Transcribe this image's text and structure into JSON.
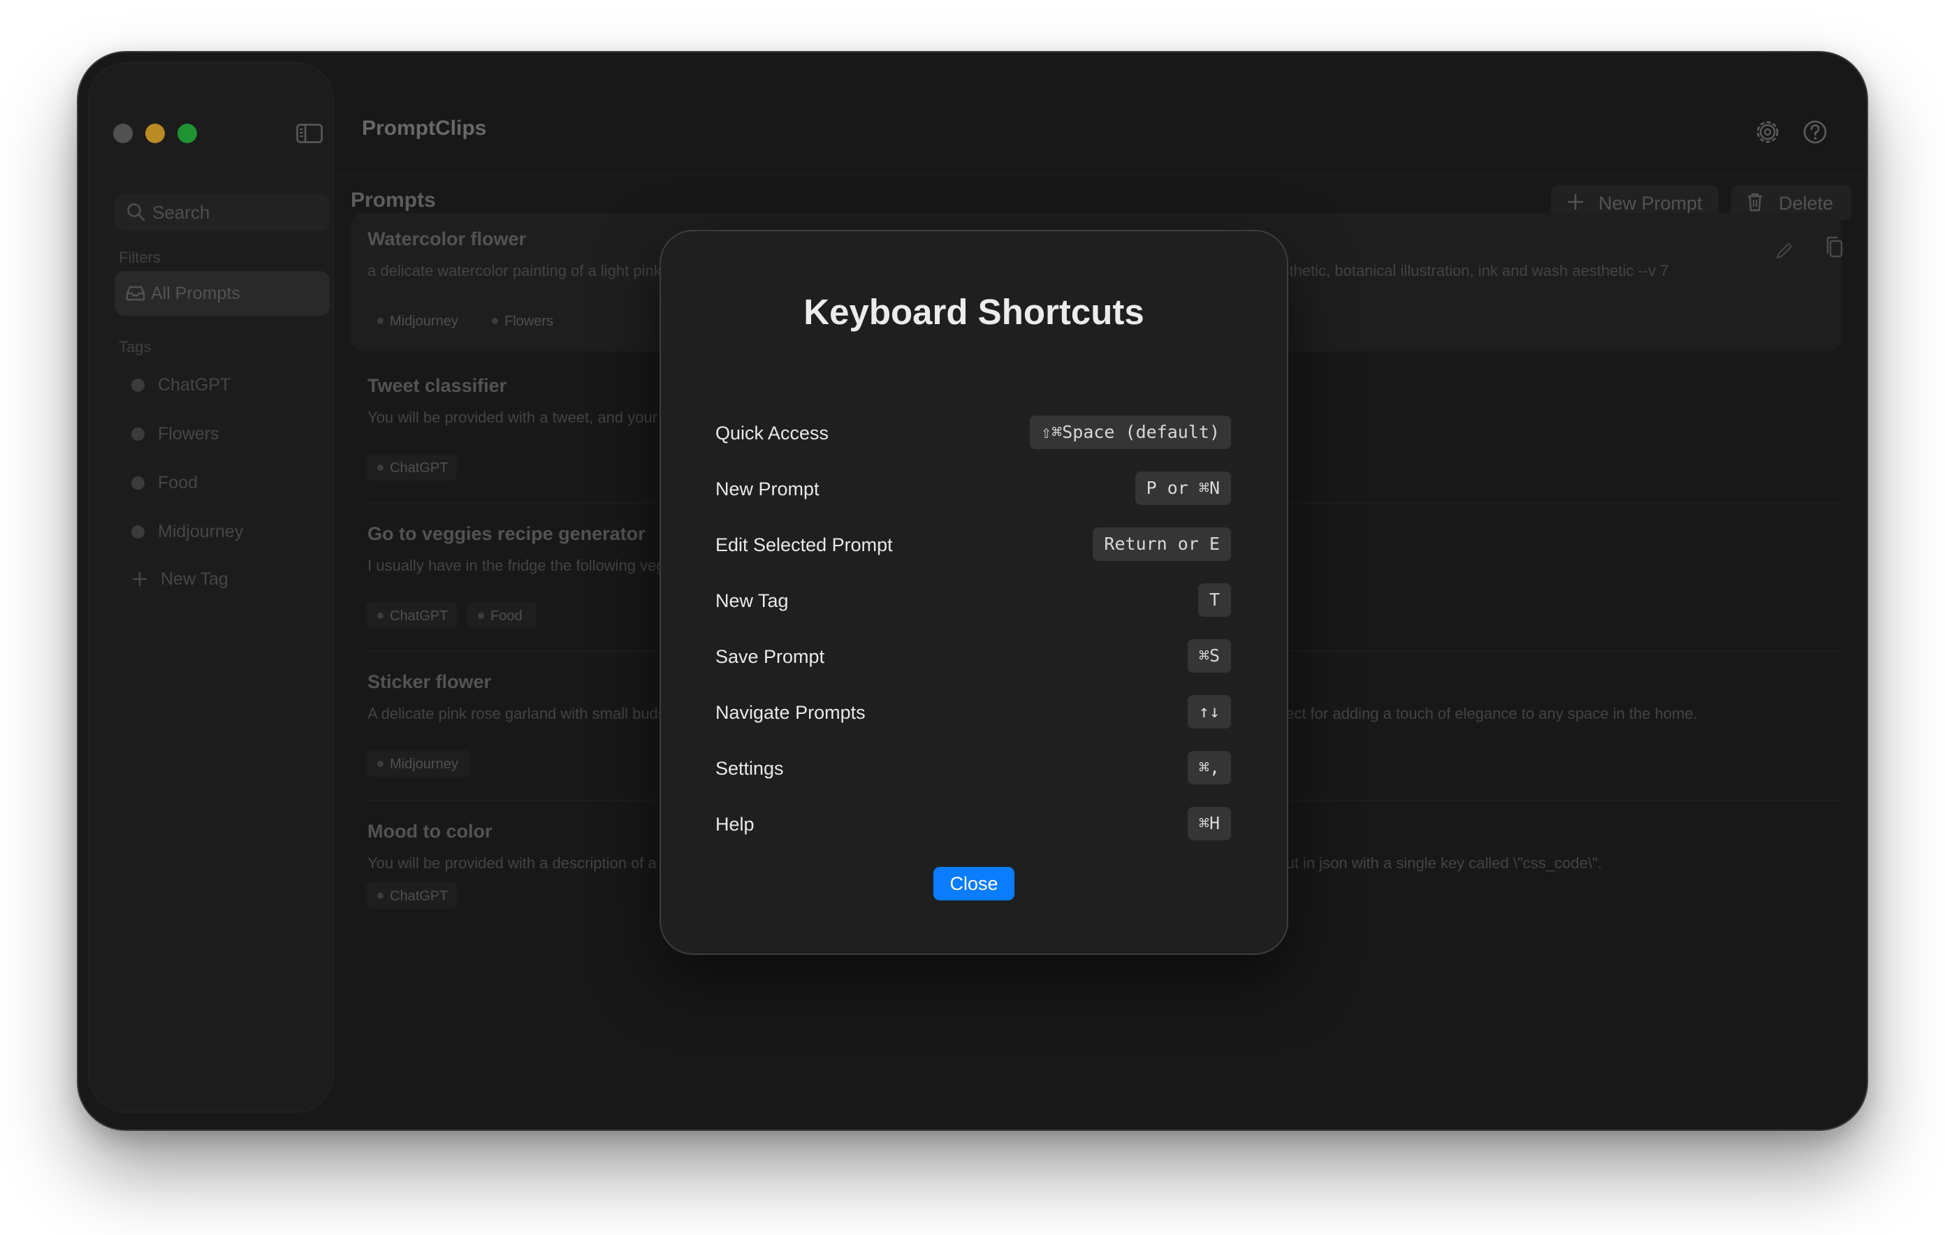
{
  "window": {
    "title": "PromptClips",
    "traffic_lights": {
      "close": "#6d6d6d",
      "minimize": "#febc2e",
      "zoom": "#28c840"
    }
  },
  "sidebar": {
    "search_placeholder": "Search",
    "filters_label": "Filters",
    "filters": [
      {
        "label": "All Prompts",
        "icon": "tray-icon",
        "selected": true
      }
    ],
    "tags_label": "Tags",
    "tags": [
      {
        "label": "ChatGPT"
      },
      {
        "label": "Flowers"
      },
      {
        "label": "Food"
      },
      {
        "label": "Midjourney"
      }
    ],
    "new_tag_label": "New Tag"
  },
  "header": {
    "section_title": "Prompts",
    "new_prompt_label": "New Prompt",
    "delete_label": "Delete",
    "icons": [
      "settings-icon",
      "help-icon"
    ]
  },
  "prompts": [
    {
      "title": "Watercolor flower",
      "description": "a delicate watercolor painting of a light pink lotus flower, soft pale green background, fine traditional Chinese drawing style, ethereal aesthetic, botanical illustration, ink and wash aesthetic --v 7",
      "tags": [
        "Midjourney",
        "Flowers"
      ],
      "selected": true
    },
    {
      "title": "Tweet classifier",
      "description": "You will be provided with a tweet, and your task is to classify its sentiment as positive, neutral, or negative.",
      "tags": [
        "ChatGPT"
      ]
    },
    {
      "title": "Go to veggies recipe generator",
      "description": "I usually have in the fridge the following vegetables.",
      "tags": [
        "ChatGPT",
        "Food"
      ]
    },
    {
      "title": "Sticker flower",
      "description": "A delicate pink rose garland with small buds and leaves, arranged in a graceful arc that exudes romance and charm. This design is perfect for adding a touch of elegance to any space in the home.",
      "tags": [
        "Midjourney"
      ]
    },
    {
      "title": "Mood to color",
      "description": "You will be provided with a description of a mood, and your task is to generate the CSS code for a color that matches it. Write your output in json with a single key called \\\"css_code\\\".",
      "tags": [
        "ChatGPT"
      ]
    }
  ],
  "modal": {
    "title": "Keyboard Shortcuts",
    "shortcuts": [
      {
        "label": "Quick Access",
        "keys": "⇧⌘Space (default)"
      },
      {
        "label": "New Prompt",
        "keys": "P or ⌘N"
      },
      {
        "label": "Edit Selected Prompt",
        "keys": "Return or E"
      },
      {
        "label": "New Tag",
        "keys": "T"
      },
      {
        "label": "Save Prompt",
        "keys": "⌘S"
      },
      {
        "label": "Navigate Prompts",
        "keys": "↑↓"
      },
      {
        "label": "Settings",
        "keys": "⌘,"
      },
      {
        "label": "Help",
        "keys": "⌘H"
      }
    ],
    "close_label": "Close",
    "accent": "#0a7cff"
  }
}
